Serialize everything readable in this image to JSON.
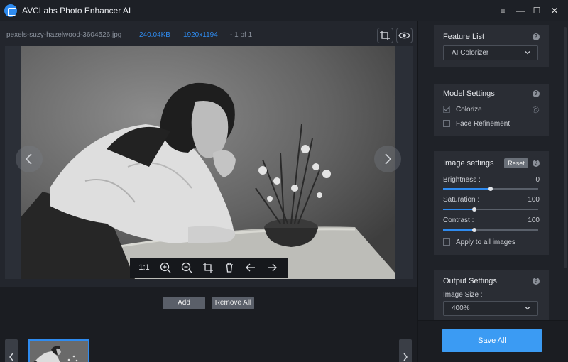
{
  "window": {
    "title": "AVCLabs Photo Enhancer AI",
    "controls": [
      "≡",
      "—",
      "☐",
      "✕"
    ]
  },
  "file": {
    "name": "pexels-suzy-hazelwood-3604526.jpg",
    "size": "240.04KB",
    "resolution": "1920x1194",
    "count": "- 1 of 1"
  },
  "toolbar": {
    "ratio_label": "1:1",
    "icons": [
      "zoom-in-icon",
      "zoom-out-icon",
      "crop-icon",
      "delete-icon",
      "undo-icon",
      "redo-icon"
    ]
  },
  "bottom": {
    "add_label": "Add",
    "remove_all_label": "Remove All"
  },
  "feature_list": {
    "title": "Feature List",
    "selected": "AI Colorizer"
  },
  "model_settings": {
    "title": "Model Settings",
    "options": [
      {
        "label": "Colorize",
        "checked": true
      },
      {
        "label": "Face Refinement",
        "checked": false
      }
    ]
  },
  "image_settings": {
    "title": "Image settings",
    "reset_label": "Reset",
    "sliders": [
      {
        "label": "Brightness :",
        "value": "0",
        "fraction": 0.5
      },
      {
        "label": "Saturation :",
        "value": "100",
        "fraction": 0.33
      },
      {
        "label": "Contrast :",
        "value": "100",
        "fraction": 0.33
      }
    ],
    "apply_all_label": "Apply to all images",
    "apply_all_checked": false
  },
  "output_settings": {
    "title": "Output Settings",
    "image_size_label": "Image Size :",
    "image_size_value": "400%"
  },
  "save_label": "Save All",
  "colors": {
    "accent": "#2f8bef",
    "save_button": "#3b9bf3",
    "panel": "#2a2d34"
  }
}
